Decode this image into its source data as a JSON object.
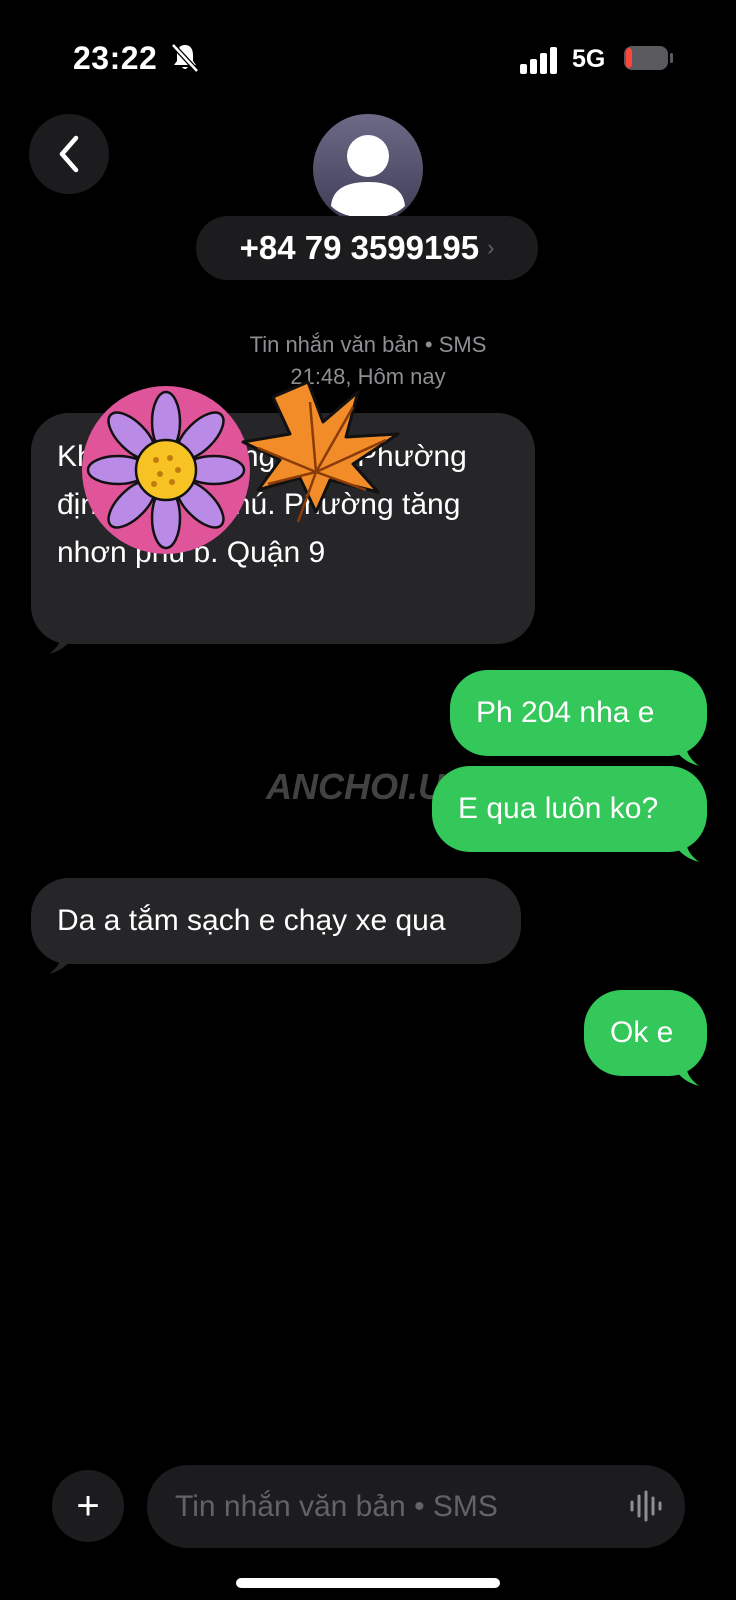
{
  "status_bar": {
    "time": "23:22",
    "network": "5G",
    "battery_color": "#ff453a"
  },
  "header": {
    "contact_number": "+84 79 3599195",
    "chevron": "›"
  },
  "thread_meta": {
    "type_label": "Tin nhắn văn bản • SMS",
    "timestamp": "21:48, Hôm nay"
  },
  "messages": [
    {
      "direction": "incoming",
      "text": "Khu hẻm đường sông Phường định Phong phú. Phường tăng nhơn phủ b. Quận 9"
    },
    {
      "direction": "outgoing",
      "text": "Ph 204 nha e"
    },
    {
      "direction": "outgoing",
      "text": "E qua luôn ko?"
    },
    {
      "direction": "incoming",
      "text": "Da a tắm sạch e chạy xe qua"
    },
    {
      "direction": "outgoing",
      "text": "Ok e"
    }
  ],
  "watermark": "ANCHOI.UK",
  "composer": {
    "placeholder": "Tin nhắn văn bản • SMS",
    "plus_label": "+"
  },
  "icons": [
    "chevron-left-icon",
    "bell-slash-icon",
    "signal-icon",
    "battery-icon",
    "person-icon",
    "plus-icon",
    "waveform-icon"
  ],
  "colors": {
    "incoming_bubble": "#262628",
    "outgoing_bubble": "#34c759",
    "background": "#000000"
  }
}
